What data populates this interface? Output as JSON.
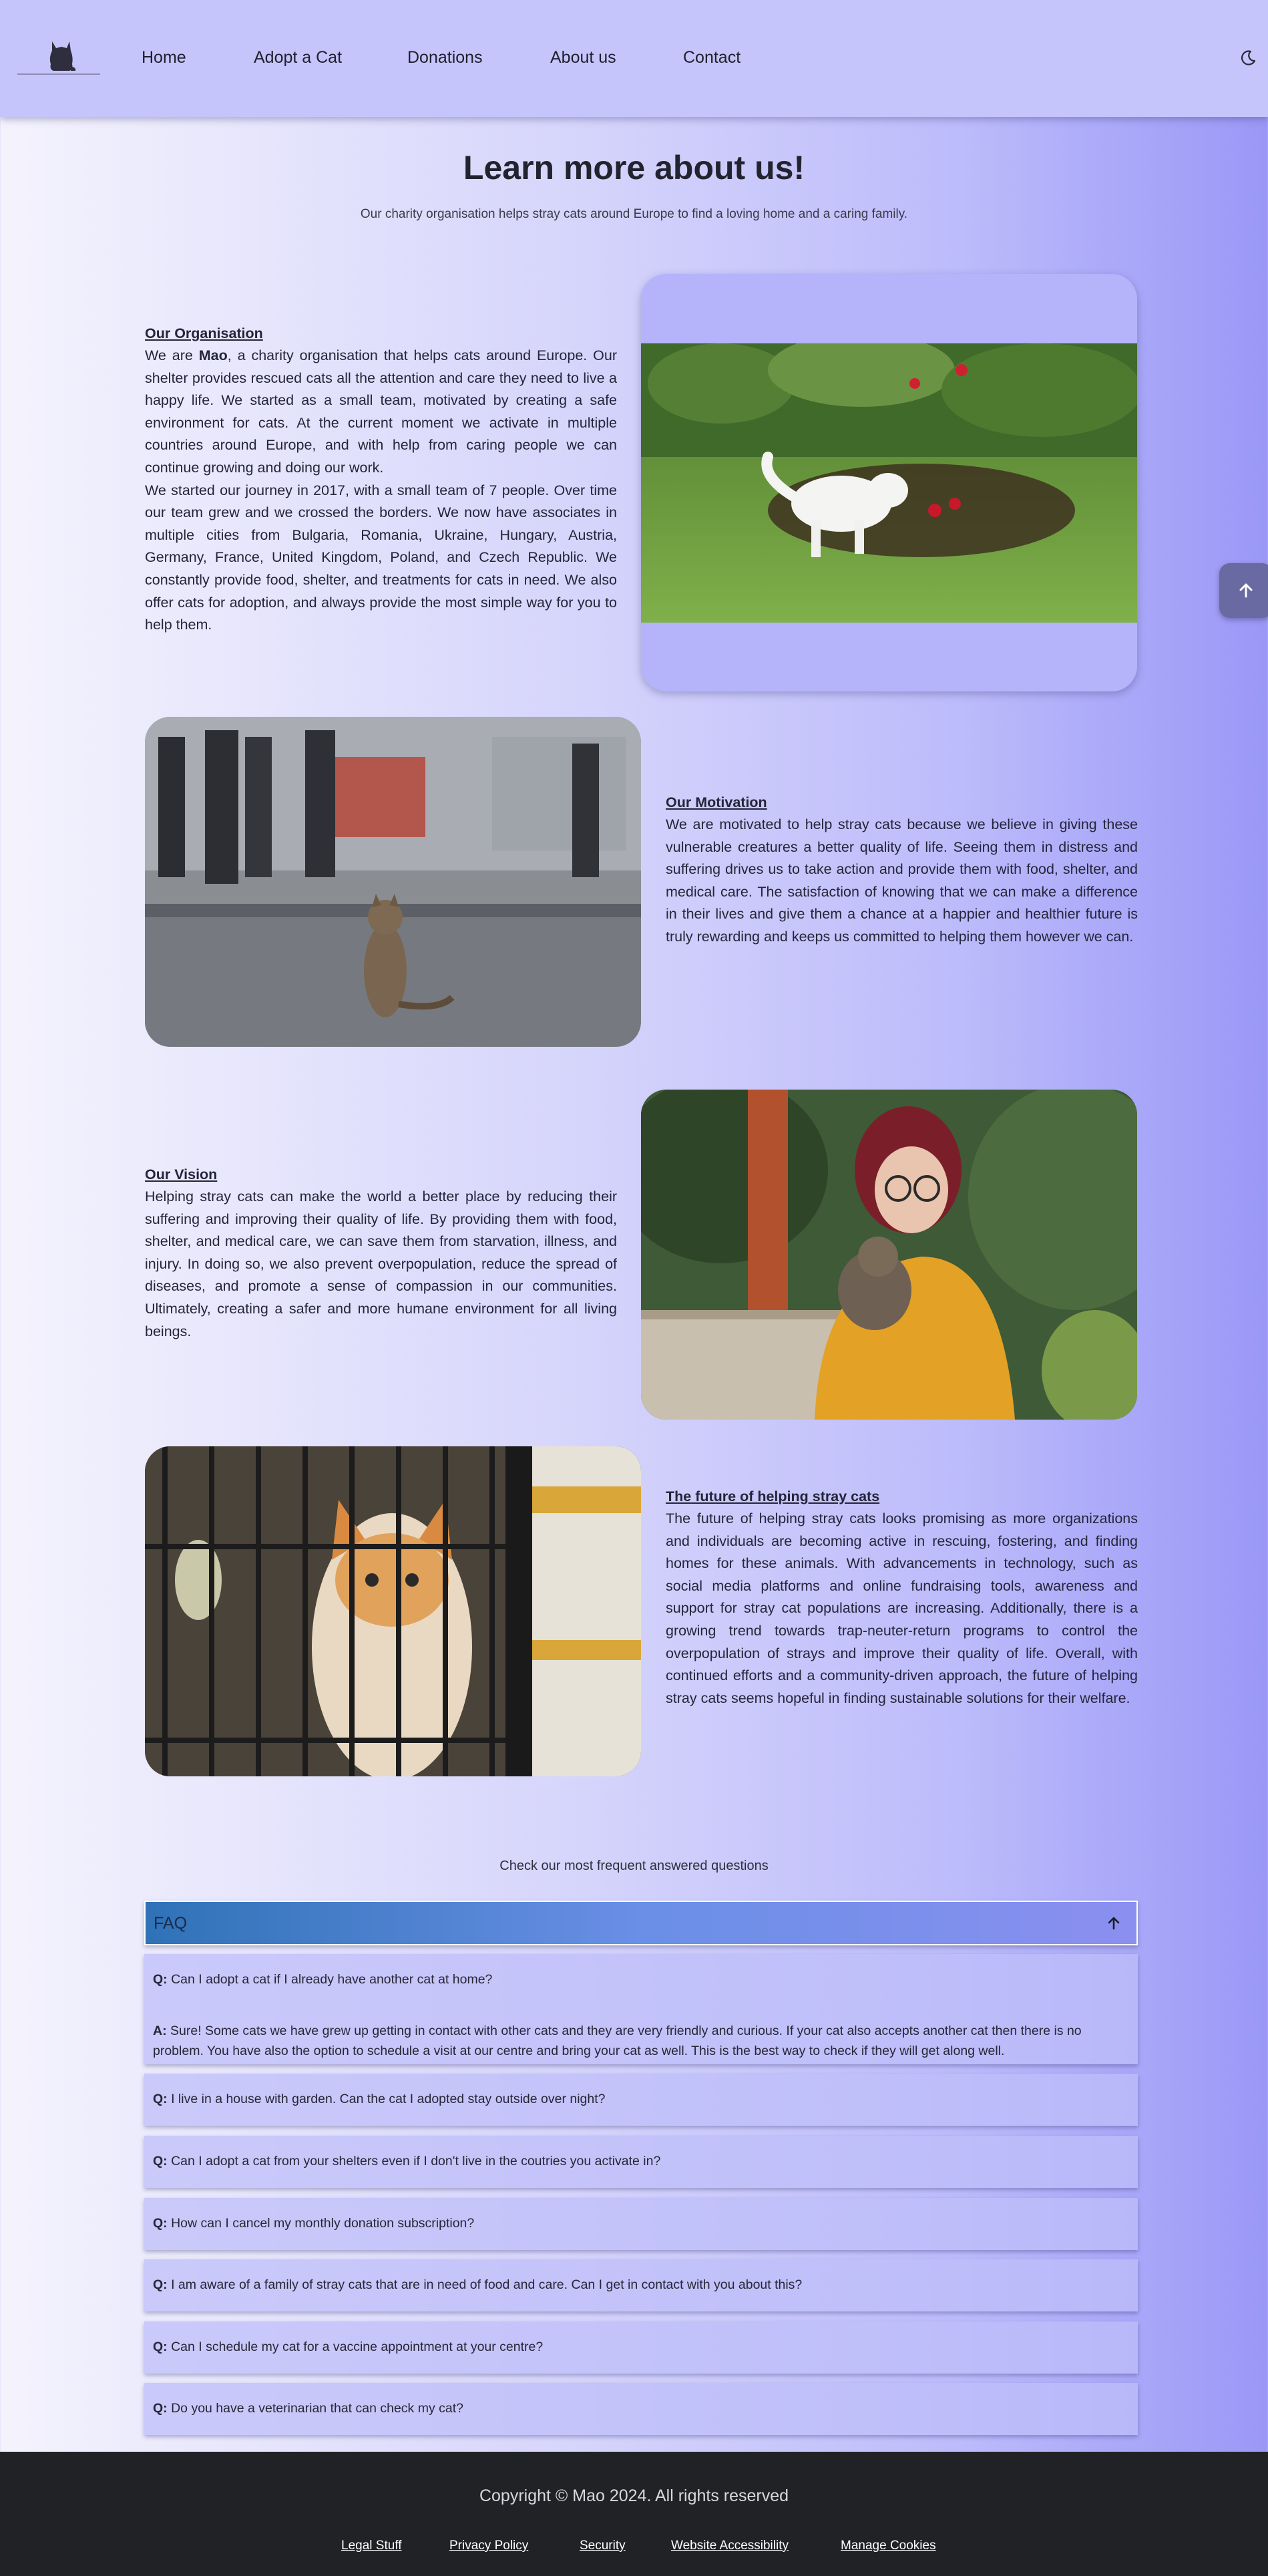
{
  "nav": {
    "links": [
      "Home",
      "Adopt a Cat",
      "Donations",
      "About us",
      "Contact"
    ]
  },
  "hero": {
    "title": "Learn more about us!",
    "subtitle": "Our charity organisation helps stray cats around Europe to find a loving home and a caring family."
  },
  "sections": {
    "organisation": {
      "heading": "Our Organisation",
      "p1_prefix": "We are ",
      "p1_name": "Mao",
      "p1_rest": ", a charity organisation that helps cats around Europe. Our shelter provides rescued cats all the attention and care they need to live a happy life. We started as a small team, motivated by creating a safe environment for cats. At the current moment we activate in multiple countries around Europe, and with help from caring people we can continue growing and doing our work.",
      "p2": "We started our journey in 2017, with a small team of 7 people. Over time our team grew and we crossed the borders. We now have associates in multiple cities from Bulgaria, Romania, Ukraine, Hungary, Austria, Germany, France, United Kingdom, Poland, and Czech Republic. We constantly provide food, shelter, and treatments for cats in need. We also offer cats for adoption, and always provide the most simple way for you to help them."
    },
    "motivation": {
      "heading": "Our Motivation",
      "text": "We are motivated to help stray cats because we believe in giving these vulnerable creatures a better quality of life. Seeing them in distress and suffering drives us to take action and provide them with food, shelter, and medical care. The satisfaction of knowing that we can make a difference in their lives and give them a chance at a happier and healthier future is truly rewarding and keeps us committed to helping them however we can."
    },
    "vision": {
      "heading": "Our Vision",
      "text": "Helping stray cats can make the world a better place by reducing their suffering and improving their quality of life. By providing them with food, shelter, and medical care, we can save them from starvation, illness, and injury. In doing so, we also prevent overpopulation, reduce the spread of diseases, and promote a sense of compassion in our communities. Ultimately, creating a safer and more humane environment for all living beings."
    },
    "future": {
      "heading": "The future of helping stray cats",
      "text": "The future of helping stray cats looks promising as more organizations and individuals are becoming active in rescuing, fostering, and finding homes for these animals. With advancements in technology, such as social media platforms and online fundraising tools, awareness and support for stray cat populations are increasing. Additionally, there is a growing trend towards trap-neuter-return programs to control the overpopulation of strays and improve their quality of life. Overall, with continued efforts and a community-driven approach, the future of helping stray cats seems hopeful in finding sustainable solutions for their welfare."
    }
  },
  "faq": {
    "caption": "Check our most frequent answered questions",
    "header": "FAQ",
    "q_prefix": "Q:",
    "a_prefix": "A:",
    "items": [
      {
        "q": "Can I adopt a cat if I already have another cat at home?",
        "a": "Sure! Some cats we have grew up getting in contact with other cats and they are very friendly and curious. If your cat also accepts another cat then there is no problem. You have also the option to schedule a visit at our centre and bring your cat as well. This is the best way to check if they will get along well."
      },
      {
        "q": "I live in a house with garden. Can the cat I adopted stay outside over night?"
      },
      {
        "q": "Can I adopt a cat from your shelters even if I don't live in the coutries you activate in?"
      },
      {
        "q": "How can I cancel my monthly donation subscription?"
      },
      {
        "q": "I am aware of a family of stray cats that are in need of food and care. Can I get in contact with you about this?"
      },
      {
        "q": "Can I schedule my cat for a vaccine appointment at your centre?"
      },
      {
        "q": "Do you have a veterinarian that can check my cat?"
      }
    ]
  },
  "footer": {
    "copyright": "Copyright © Mao 2024. All rights reserved",
    "links": [
      "Legal Stuff",
      "Privacy Policy",
      "Security",
      "Website Accessibility",
      "Manage Cookies"
    ]
  },
  "icons": {
    "logo": "cat-logo-icon",
    "theme": "moon-icon",
    "faq_toggle": "arrow-up-icon",
    "back_to_top": "arrow-up-icon"
  },
  "colors": {
    "navbar": "#c5c5fb",
    "footer": "#212226",
    "faq_header_start": "#2f72b7",
    "faq_header_end": "#8b8ff0",
    "fab": "#6a6aa3"
  }
}
